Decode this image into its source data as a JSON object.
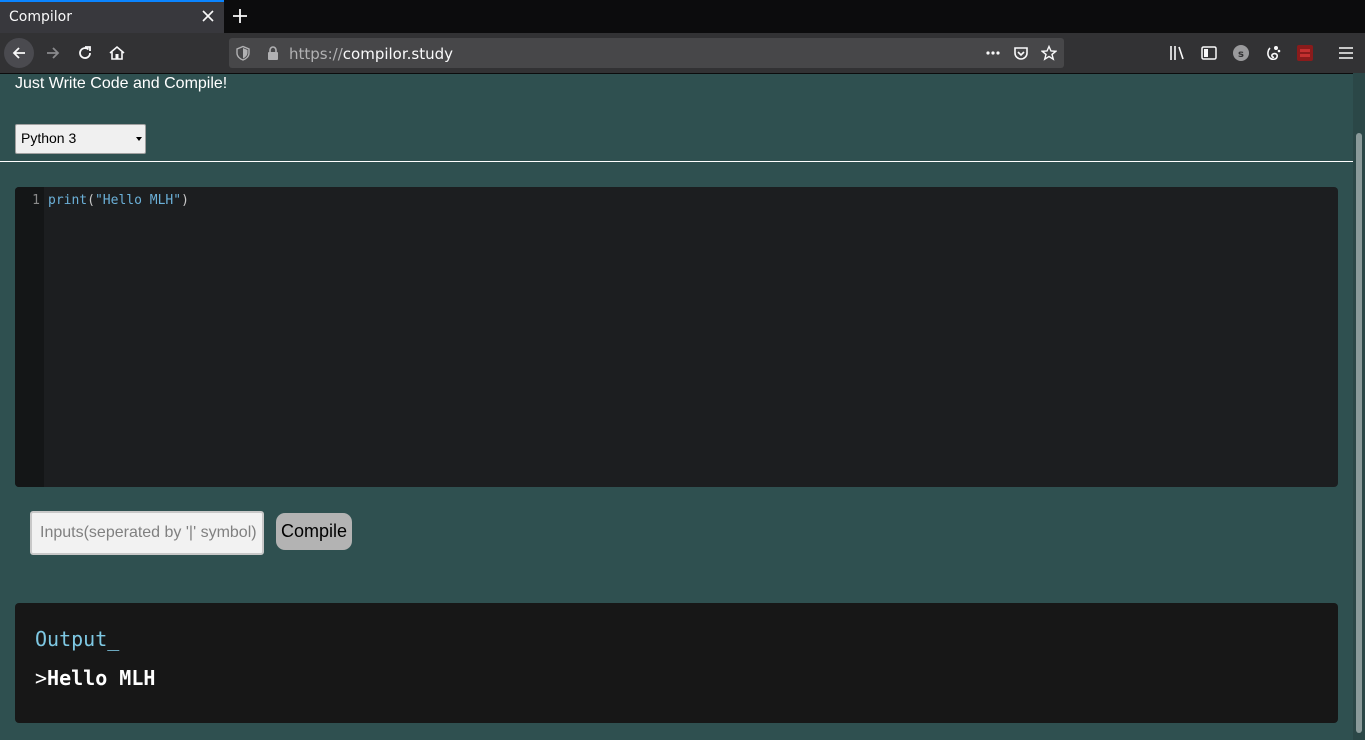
{
  "browser": {
    "tab_title": "Compilor",
    "url_protocol": "https://",
    "url_host": "compilor.study",
    "icons": [
      "back-icon",
      "forward-icon",
      "reload-icon",
      "home-icon",
      "shield-icon",
      "lock-icon",
      "more-icon",
      "pocket-icon",
      "bookmark-star-icon",
      "library-icon",
      "sidebar-icon",
      "extension-s-icon",
      "extension-gnome-icon",
      "extension-cors-icon",
      "menu-icon"
    ]
  },
  "page": {
    "tagline": "Just Write Code and Compile!",
    "language_select": {
      "selected": "Python 3"
    },
    "editor": {
      "line_number": "1",
      "code_fn": "print",
      "code_open": "(",
      "code_string": "\"Hello MLH\"",
      "code_close": ")"
    },
    "inputs": {
      "placeholder": "Inputs(seperated by '|' symbol)",
      "value": ""
    },
    "compile_label": "Compile",
    "output": {
      "title": "Output_",
      "prompt": ">",
      "text": "Hello MLH"
    }
  },
  "colors": {
    "page_background": "#2f5050",
    "editor_background": "#1c1e20",
    "output_background": "#171717",
    "accent_tab": "#0a84ff"
  }
}
